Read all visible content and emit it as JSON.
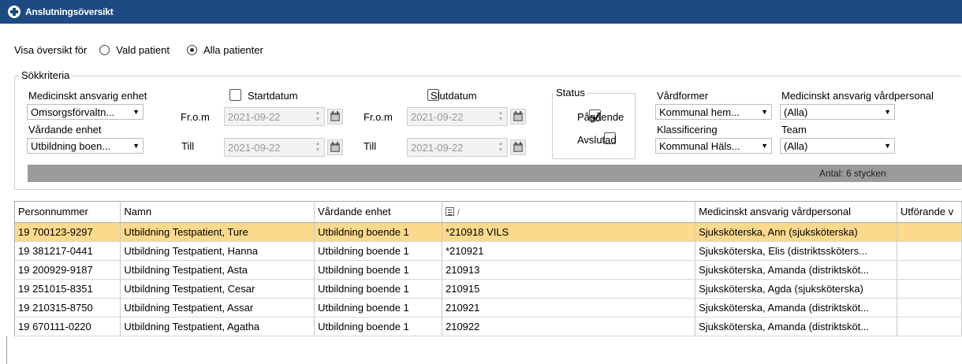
{
  "window": {
    "title": "Anslutningsöversikt"
  },
  "overview": {
    "label": "Visa översikt för",
    "option_selected_patient": "Vald patient",
    "option_all_patients": "Alla patienter",
    "selected": "Alla patienter"
  },
  "criteria": {
    "title": "Sökkriteria",
    "med_unit_label": "Medicinskt ansvarig enhet",
    "med_unit_value": "Omsorgsförvaltn...",
    "care_unit_label": "Vårdande enhet",
    "care_unit_value": "Utbildning boen...",
    "start": {
      "label": "Startdatum",
      "checked": false,
      "from_label": "Fr.o.m",
      "from_value": "2021-09-22",
      "to_label": "Till",
      "to_value": "2021-09-22"
    },
    "end": {
      "label": "Slutdatum",
      "checked": false,
      "from_label": "Fr.o.m",
      "from_value": "2021-09-22",
      "to_label": "Till",
      "to_value": "2021-09-22"
    },
    "status": {
      "title": "Status",
      "ongoing_label": "Pågående",
      "ongoing_checked": true,
      "finished_label": "Avslutad",
      "finished_checked": false
    },
    "care_forms_label": "Vårdformer",
    "care_forms_value": "Kommunal hem...",
    "classification_label": "Klassificering",
    "classification_value": "Kommunal Häls...",
    "med_staff_label": "Medicinskt ansvarig vårdpersonal",
    "med_staff_value": "(Alla)",
    "team_label": "Team",
    "team_value": "(Alla)"
  },
  "count_text": "Antal: 6 stycken",
  "table": {
    "columns": [
      "Personnummer",
      "Namn",
      "Vårdande enhet",
      "",
      "Medicinskt ansvarig vårdpersonal",
      "Utförande v"
    ],
    "sort_marker": "/",
    "rows": [
      {
        "personnummer": "19 700123-9297",
        "namn": "Utbildning Testpatient, Ture",
        "enhet": "Utbildning boende 1",
        "kod": "*210918 VILS",
        "personal": "Sjuksköterska, Ann (sjuksköterska)",
        "utf": "",
        "selected": true
      },
      {
        "personnummer": "19 381217-0441",
        "namn": "Utbildning Testpatient, Hanna",
        "enhet": "Utbildning boende 1",
        "kod": "*210921",
        "personal": "Sjuksköterska, Elis (distriktssköters...",
        "utf": ""
      },
      {
        "personnummer": "19 200929-9187",
        "namn": "Utbildning Testpatient, Asta",
        "enhet": "Utbildning boende 1",
        "kod": "210913",
        "personal": "Sjuksköterska, Amanda (distriktsköt...",
        "utf": ""
      },
      {
        "personnummer": "19 251015-8351",
        "namn": "Utbildning Testpatient, Cesar",
        "enhet": "Utbildning boende 1",
        "kod": "210915",
        "personal": "Sjuksköterska, Agda (sjuksköterska)",
        "utf": ""
      },
      {
        "personnummer": "19 210315-8750",
        "namn": "Utbildning Testpatient, Assar",
        "enhet": "Utbildning boende 1",
        "kod": "210921",
        "personal": "Sjuksköterska, Amanda (distriktsköt...",
        "utf": ""
      },
      {
        "personnummer": "19 670111-0220",
        "namn": "Utbildning Testpatient, Agatha",
        "enhet": "Utbildning boende 1",
        "kod": "210922",
        "personal": "Sjuksköterska, Amanda (distriktsköt...",
        "utf": ""
      }
    ]
  },
  "colors": {
    "titlebar": "#1d4a83",
    "selected_row": "#fbd98d",
    "count_bar": "#9a9a9a"
  }
}
